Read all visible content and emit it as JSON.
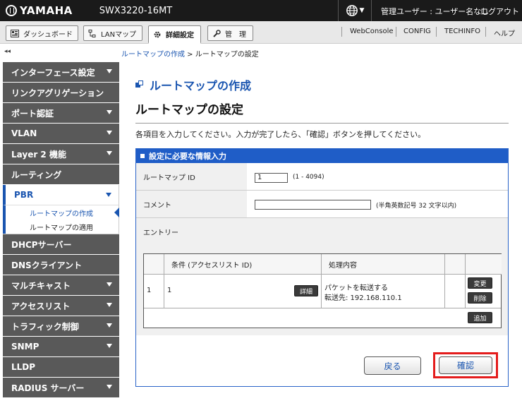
{
  "header": {
    "brand": "YAMAHA",
    "model": "SWX3220-16MT",
    "user_info": "管理ユーザー : ユーザー名なし",
    "logout": "ログアウト"
  },
  "toolbar": {
    "dashboard": "ダッシュボード",
    "lanmap": "LANマップ",
    "detail": "詳細設定",
    "admin": "管　理",
    "links": [
      "WebConsole",
      "CONFIG",
      "TECHINFO",
      "ヘルプ"
    ]
  },
  "breadcrumb": {
    "collapse": "◂◂",
    "parent": "ルートマップの作成",
    "separator": " > ",
    "current": "ルートマップの設定"
  },
  "sidebar": {
    "items_top": [
      "インターフェース設定",
      "リンクアグリゲーション",
      "ポート認証",
      "VLAN",
      "Layer 2 機能",
      "ルーティング"
    ],
    "pbr": "PBR",
    "pbr_sub": [
      "ルートマップの作成",
      "ルートマップの適用"
    ],
    "items_bottom": [
      "DHCPサーバー",
      "DNSクライアント",
      "マルチキャスト",
      "アクセスリスト",
      "トラフィック制御",
      "SNMP",
      "LLDP",
      "RADIUS サーバー"
    ]
  },
  "main": {
    "title": "ルートマップの作成",
    "subtitle": "ルートマップの設定",
    "instruction": "各項目を入力してください。入力が完了したら、「確認」ボタンを押してください。",
    "panel_title": "設定に必要な情報入力",
    "routemap_id_label": "ルートマップ ID",
    "routemap_id_value": "1",
    "routemap_id_hint": "(1 - 4094)",
    "comment_label": "コメント",
    "comment_value": "",
    "comment_hint": "(半角英数記号 32 文字以内)",
    "entry_label": "エントリー",
    "table": {
      "col_condition": "条件 (アクセスリスト ID)",
      "col_action": "処理内容",
      "row": {
        "seq": "1",
        "acl": "1",
        "detail_btn": "詳細",
        "action_line1": "パケットを転送する",
        "action_line2": "転送先: 192.168.110.1",
        "change_btn": "変更",
        "delete_btn": "削除"
      },
      "add_btn": "追加"
    },
    "back_btn": "戻る",
    "confirm_btn": "確認"
  }
}
